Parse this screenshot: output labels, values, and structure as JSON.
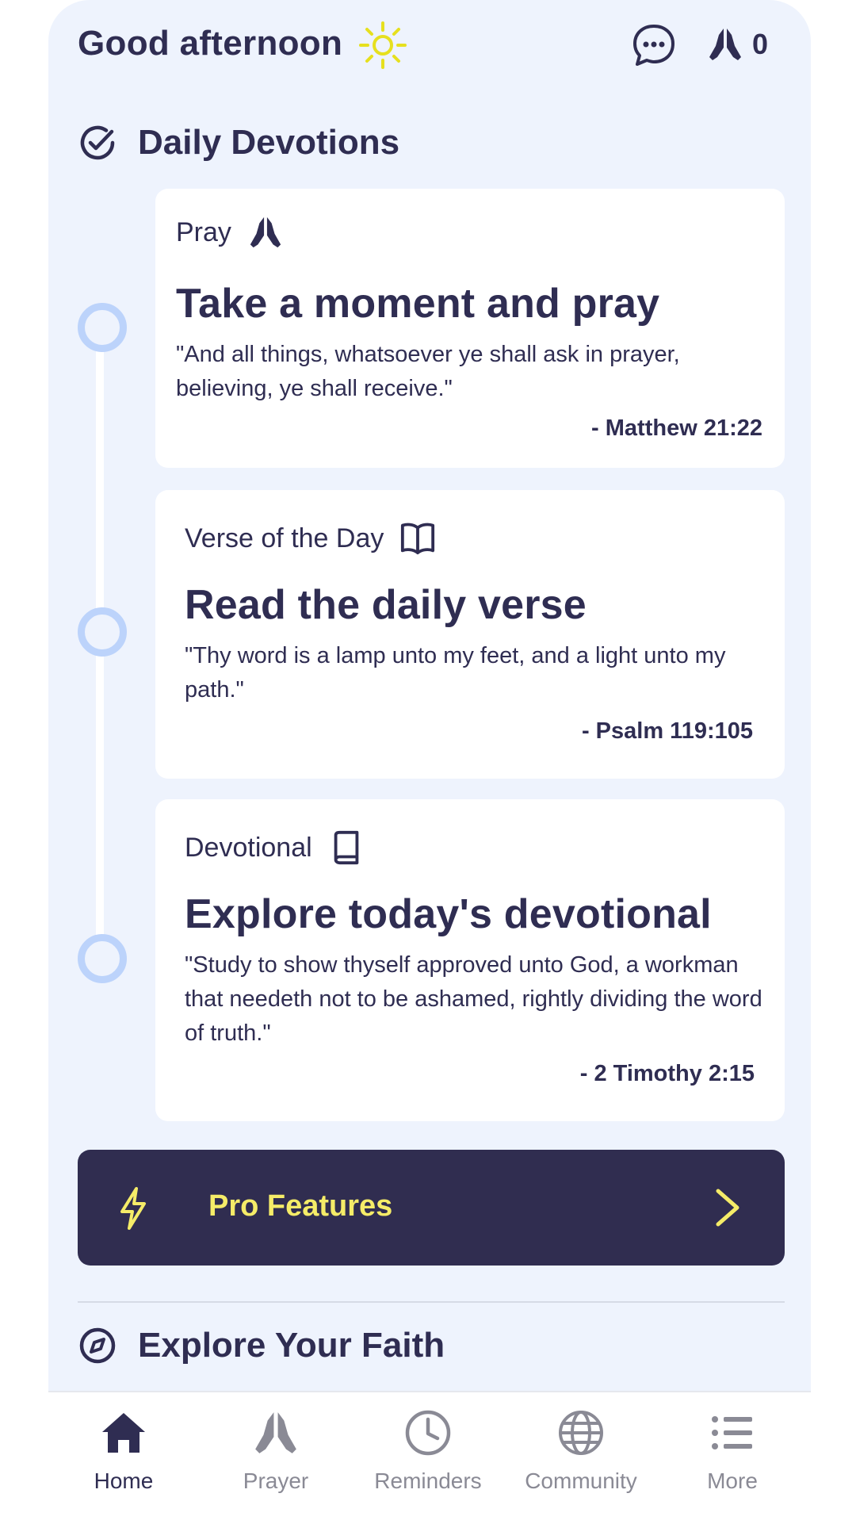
{
  "header": {
    "greeting": "Good afternoon",
    "greeting_icon": "sun-icon",
    "chat_icon": "chat-bubble-icon",
    "prayer_count": "0",
    "prayer_icon": "praying-hands-icon"
  },
  "devotions": {
    "title": "Daily Devotions",
    "icon": "check-circle-icon",
    "cards": [
      {
        "type": "Pray",
        "icon": "praying-hands-icon",
        "title": "Take a moment and pray",
        "quote": "\"And all things, whatsoever ye shall ask in prayer, believing, ye shall receive.\"",
        "reference": "- Matthew 21:22"
      },
      {
        "type": "Verse of the Day",
        "icon": "open-book-icon",
        "title": "Read the daily verse",
        "quote": "\"Thy word is a lamp unto my feet, and a light unto my path.\"",
        "reference": "- Psalm 119:105"
      },
      {
        "type": "Devotional",
        "icon": "book-icon",
        "title": "Explore today's devotional",
        "quote": "\"Study to show thyself approved unto God, a workman that needeth not to be ashamed, rightly dividing the word of truth.\"",
        "reference": "- 2 Timothy 2:15"
      }
    ]
  },
  "pro": {
    "label": "Pro Features",
    "icon": "lightning-icon"
  },
  "explore": {
    "title": "Explore Your Faith",
    "icon": "compass-icon"
  },
  "nav": {
    "items": [
      {
        "label": "Home",
        "icon": "home-icon",
        "active": true
      },
      {
        "label": "Prayer",
        "icon": "praying-hands-icon",
        "active": false
      },
      {
        "label": "Reminders",
        "icon": "clock-icon",
        "active": false
      },
      {
        "label": "Community",
        "icon": "globe-icon",
        "active": false
      },
      {
        "label": "More",
        "icon": "list-icon",
        "active": false
      }
    ]
  },
  "colors": {
    "background": "#eef3fd",
    "text": "#2f2d52",
    "accent_yellow": "#f5ec68",
    "pro_bg": "#302d50",
    "timeline": "#bcd3fb"
  }
}
